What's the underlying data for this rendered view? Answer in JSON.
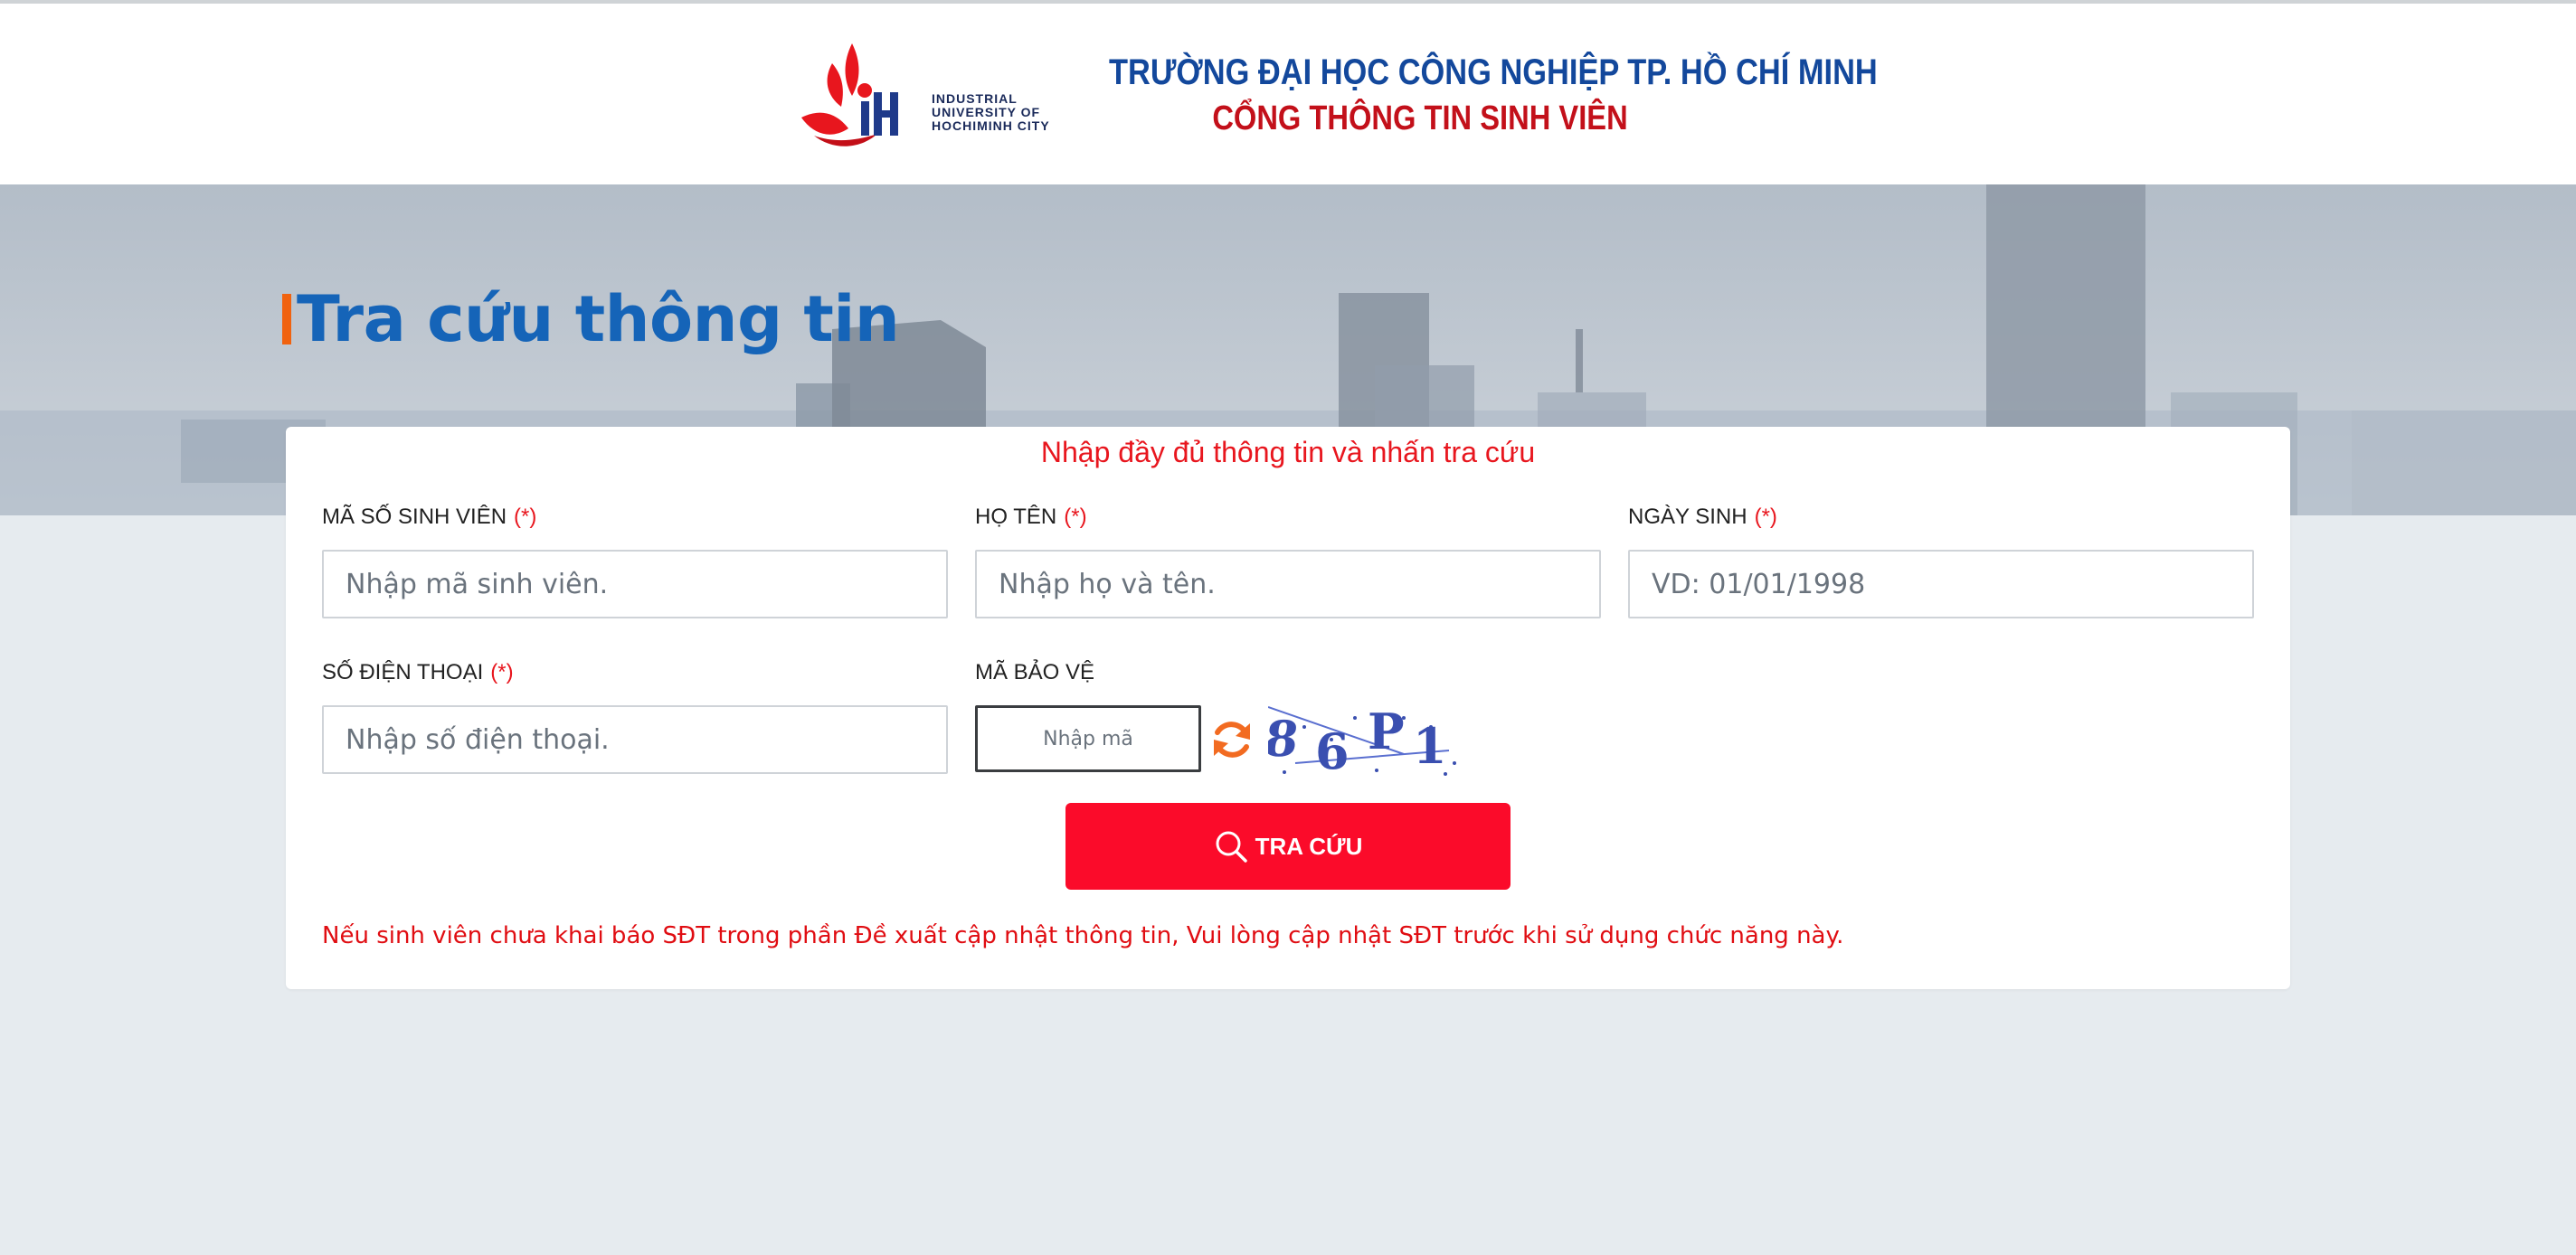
{
  "header": {
    "logo_text": [
      "INDUSTRIAL",
      "UNIVERSITY OF",
      "HOCHIMINH CITY"
    ],
    "school_name": "TRƯỜNG ĐẠI HỌC CÔNG NGHIỆP TP. HỒ CHÍ MINH",
    "portal_name": "CỔNG THÔNG TIN SINH VIÊN"
  },
  "page": {
    "title": "Tra cứu thông tin"
  },
  "form": {
    "instruction": "Nhập đầy đủ thông tin và nhấn tra cứu",
    "required_mark": "(*)",
    "student_id": {
      "label": "MÃ SỐ SINH VIÊN",
      "placeholder": "Nhập mã sinh viên.",
      "value": ""
    },
    "full_name": {
      "label": "HỌ TÊN",
      "placeholder": "Nhập họ và tên.",
      "value": ""
    },
    "birth_date": {
      "label": "NGÀY SINH",
      "placeholder": "VD: 01/01/1998",
      "value": ""
    },
    "phone": {
      "label": "SỐ ĐIỆN THOẠI",
      "placeholder": "Nhập số điện thoại.",
      "value": ""
    },
    "captcha": {
      "label": "MÃ BẢO VỆ",
      "placeholder": "Nhập mã",
      "value": "",
      "image_text": "86P1"
    },
    "search_button": "TRA CỨU",
    "note": "Nếu sinh viên chưa khai báo SĐT trong phần Đề xuất cập nhật thông tin, Vui lòng cập nhật SĐT trước khi sử dụng chức năng này."
  },
  "colors": {
    "accent_red": "#fb0b2a",
    "title_blue": "#1564b8",
    "title_bar_orange": "#f0620f",
    "school_blue": "#13489c",
    "portal_red": "#c3101a"
  }
}
